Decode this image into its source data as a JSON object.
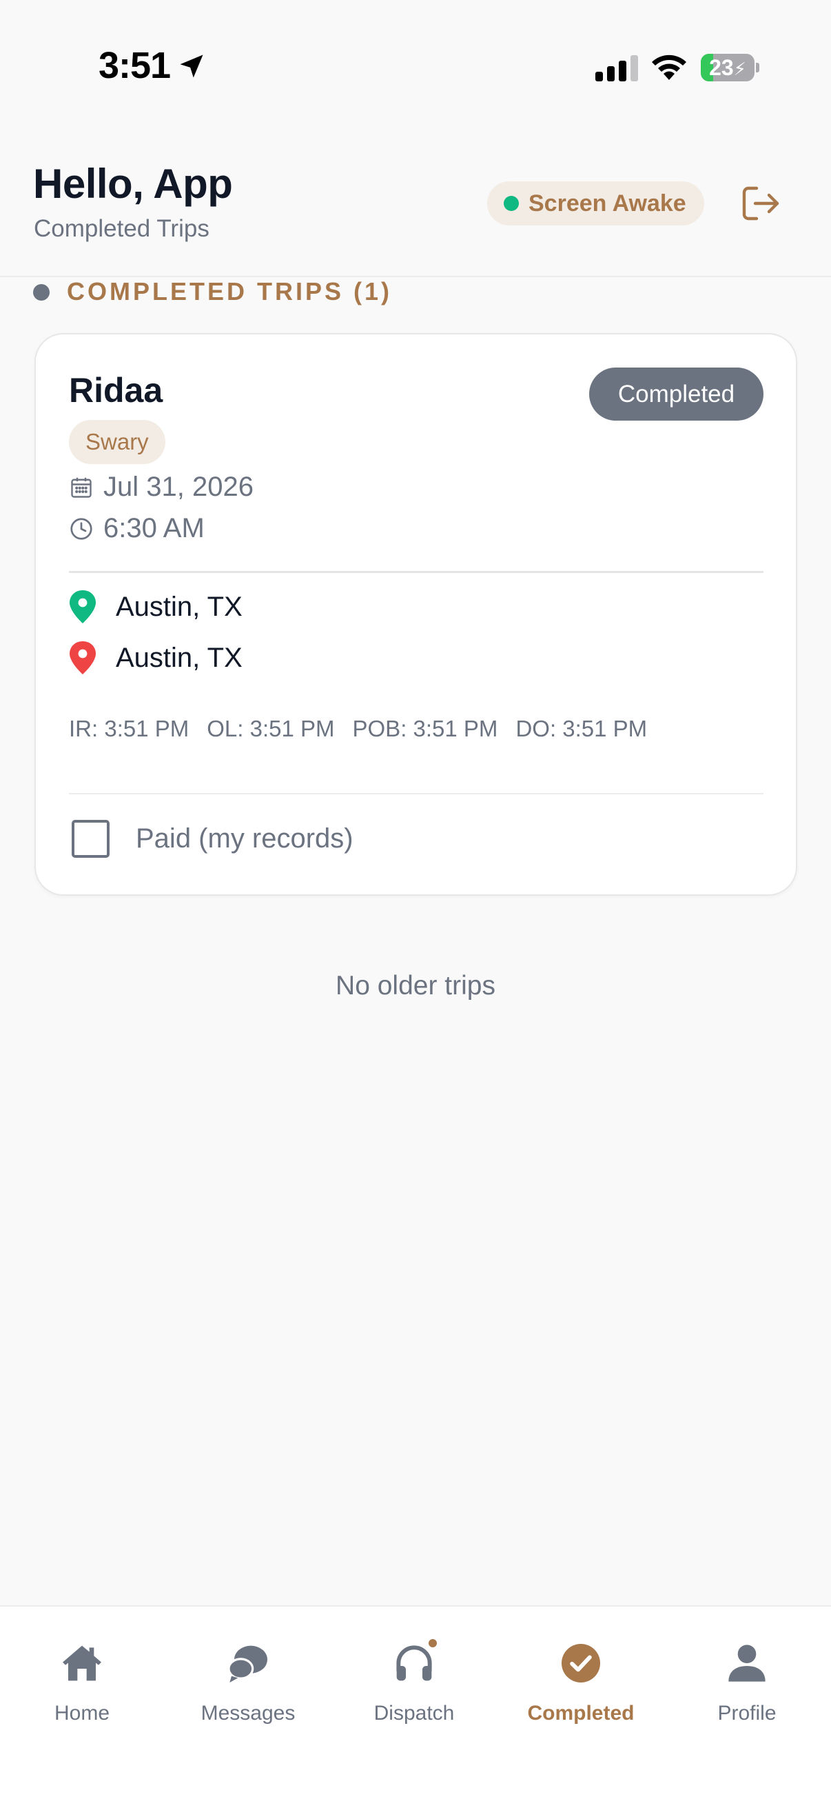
{
  "status_bar": {
    "time": "3:51",
    "battery_text": "23",
    "battery_level": 0.23,
    "colors": {
      "battery_charging": "#34c759"
    }
  },
  "header": {
    "greeting": "Hello, App",
    "subtitle": "Completed Trips",
    "screen_awake_label": "Screen Awake",
    "logout_icon": "logout-icon"
  },
  "section": {
    "title": "COMPLETED TRIPS (1)"
  },
  "trip": {
    "rider": "Ridaa",
    "status": "Completed",
    "tag": "Swary",
    "date": "Jul 31, 2026",
    "time": "6:30 AM",
    "pickup": "Austin, TX",
    "dropoff": "Austin, TX",
    "timestamps": {
      "ir": "IR: 3:51 PM",
      "ol": "OL: 3:51 PM",
      "pob": "POB: 3:51 PM",
      "do": "DO: 3:51 PM"
    },
    "paid_label": "Paid (my records)",
    "paid_checked": false
  },
  "empty_message": "No older trips",
  "tabs": [
    {
      "label": "Home",
      "icon": "home-icon"
    },
    {
      "label": "Messages",
      "icon": "messages-icon"
    },
    {
      "label": "Dispatch",
      "icon": "headphones-icon"
    },
    {
      "label": "Completed",
      "icon": "check-circle-icon",
      "active": true
    },
    {
      "label": "Profile",
      "icon": "profile-icon"
    }
  ],
  "colors": {
    "accent": "#a8784b",
    "accent_soft": "#f3ece4",
    "muted": "#6b7280",
    "success": "#10b981",
    "danger": "#ef4444",
    "status_pill": "#6b7280"
  }
}
